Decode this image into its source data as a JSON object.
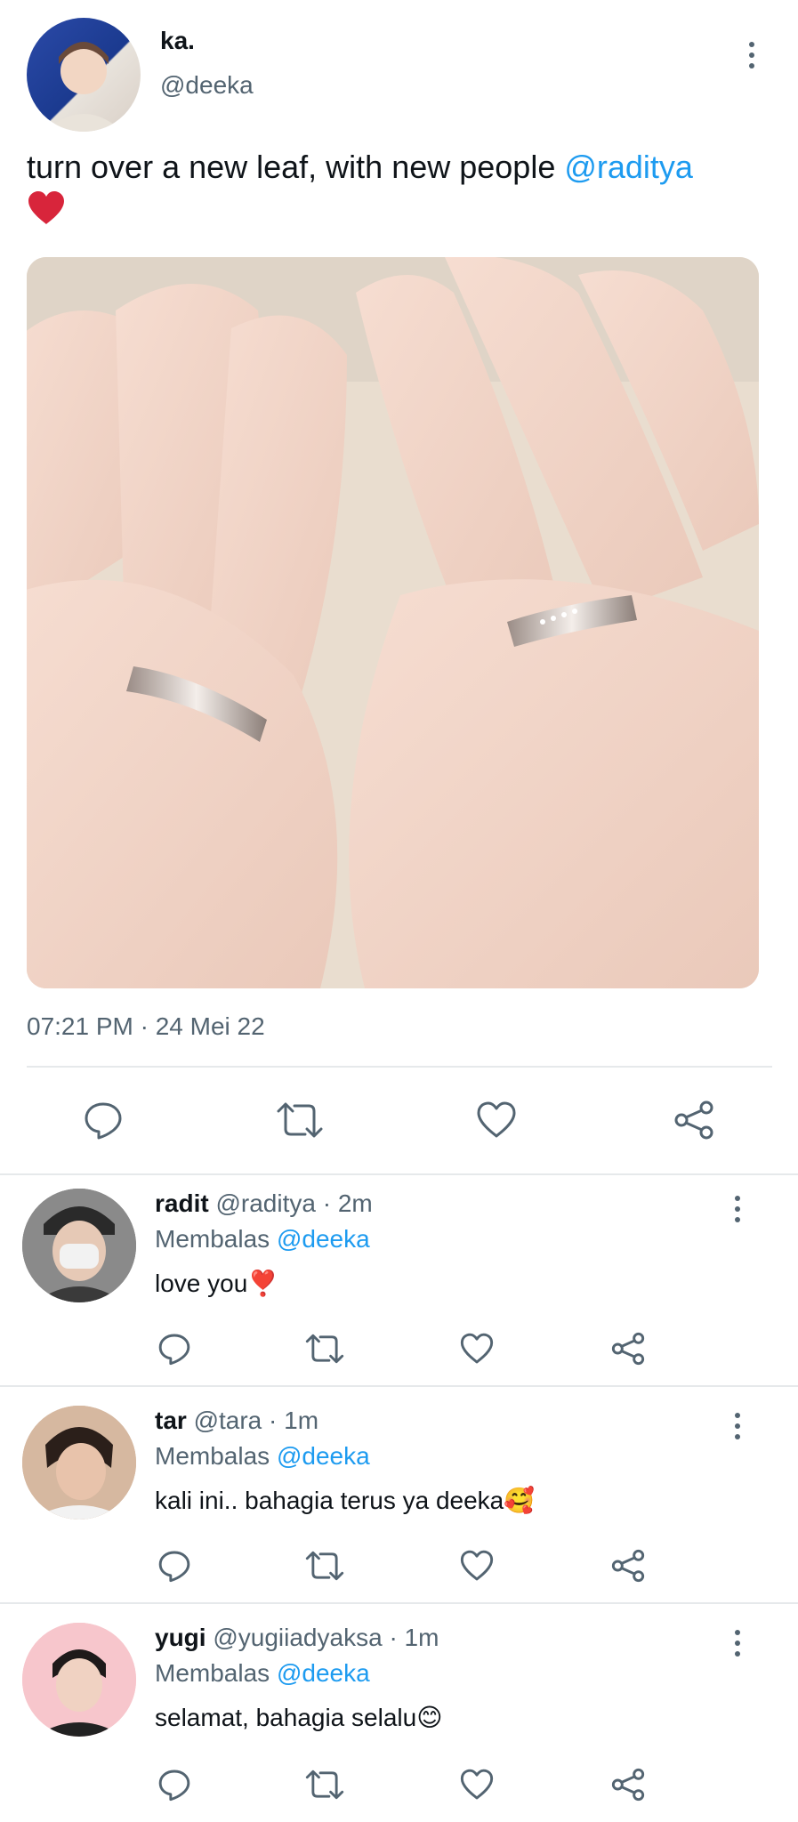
{
  "post": {
    "display_name": "ka.",
    "handle": "@deeka",
    "text_before": "turn over a new leaf, with new people ",
    "mention": "@raditya",
    "emoji": "❤️",
    "timestamp": "07:21 PM · 24 Mei 22",
    "image_alt": "two hands wearing matching rings"
  },
  "icons": {
    "reply": "reply-icon",
    "retweet": "retweet-icon",
    "like": "heart-icon",
    "share": "share-icon",
    "more": "more-vert-icon"
  },
  "colors": {
    "link": "#1d9bf0",
    "muted": "#536471",
    "emoji_red": "#d8253b"
  },
  "replies": [
    {
      "name": "radit",
      "handle": "@raditya",
      "time": "· 2m",
      "replying_label": "Membalas",
      "replying_to": "@deeka",
      "text": "love you",
      "emoji": "❣️"
    },
    {
      "name": "tar",
      "handle": "@tara",
      "time": "· 1m",
      "replying_label": "Membalas",
      "replying_to": "@deeka",
      "text": "kali ini.. bahagia terus ya deeka",
      "emoji": "🥰"
    },
    {
      "name": "yugi",
      "handle": "@yugiiadyaksa",
      "time": "· 1m",
      "replying_label": "Membalas",
      "replying_to": "@deeka",
      "text": "selamat, bahagia selalu",
      "emoji": "😊"
    }
  ]
}
